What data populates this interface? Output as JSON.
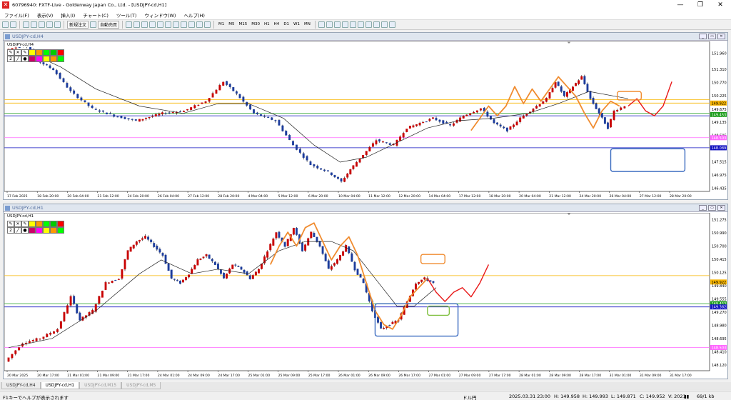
{
  "window": {
    "title": "60796940: FXTF-Live - Goldenway Japan Co., Ltd. - [USDJPY-cd,H1]",
    "minimize": "—",
    "restore": "❐",
    "close": "✕"
  },
  "menu": [
    "ファイル(F)",
    "表示(V)",
    "挿入(I)",
    "チャート(C)",
    "ツール(T)",
    "ウィンドウ(W)",
    "ヘルプ(H)"
  ],
  "toolbar": {
    "new_order": "新規注文",
    "auto_trade": "自動売買",
    "timeframes": [
      "M1",
      "M5",
      "M15",
      "M30",
      "H1",
      "H4",
      "D1",
      "W1",
      "MN"
    ]
  },
  "palette": {
    "num": "2",
    "colors": [
      "#ffff00",
      "#ff9900",
      "#00ff00",
      "#00cc00",
      "#ff0000",
      "#cc0066",
      "#ff00ff"
    ]
  },
  "icons": {
    "cross": "✕",
    "pen": "✎",
    "line": "╱",
    "dot": "●"
  },
  "charts": {
    "h4": {
      "window_title": "USDJPY-cd,H4",
      "symbol": "USDJPY-cd,H4",
      "price_labels": [
        "152.390",
        "151.960",
        "151.310",
        "150.770",
        "150.225",
        "149.675",
        "149.135",
        "148.595",
        "148.055",
        "147.515",
        "146.975",
        "146.435"
      ],
      "price_range": [
        146.3,
        152.45
      ],
      "tags": [
        {
          "text": "149.922",
          "price": 149.922,
          "bg": "#f7b500",
          "fg": "#000000"
        },
        {
          "text": "149.453",
          "price": 149.453,
          "bg": "#1a9c1a",
          "fg": "#ffffff"
        },
        {
          "text": "148.503",
          "price": 148.503,
          "bg": "#ff66ff",
          "fg": "#ffffff"
        },
        {
          "text": "148.089",
          "price": 148.089,
          "bg": "#1010c0",
          "fg": "#ffffff"
        }
      ],
      "hlines": [
        {
          "price": 150.06,
          "color": "#f7b500"
        },
        {
          "price": 149.922,
          "color": "#f7b500"
        },
        {
          "price": 149.5,
          "color": "#1a9c1a"
        },
        {
          "price": 149.4,
          "color": "#1010c0"
        },
        {
          "price": 148.503,
          "color": "#ff66ff"
        },
        {
          "price": 148.089,
          "color": "#1010c0"
        }
      ],
      "time_labels": [
        "17 Feb 2025",
        "18 Feb 20:00",
        "20 Feb 04:00",
        "21 Feb 12:00",
        "24 Feb 20:00",
        "26 Feb 04:00",
        "27 Feb 12:00",
        "28 Feb 20:00",
        "4 Mar 04:00",
        "5 Mar 12:00",
        "6 Mar 20:00",
        "10 Mar 04:00",
        "11 Mar 12:00",
        "12 Mar 20:00",
        "14 Mar 04:00",
        "17 Mar 12:00",
        "18 Mar 20:00",
        "20 Mar 04:00",
        "21 Mar 12:00",
        "24 Mar 20:00",
        "26 Mar 04:00",
        "27 Mar 12:00",
        "28 Mar 20:00"
      ],
      "path": [
        [
          0,
          152.1
        ],
        [
          10,
          152.3
        ],
        [
          16,
          151.6
        ],
        [
          22,
          151.3
        ],
        [
          30,
          150.4
        ],
        [
          40,
          149.7
        ],
        [
          50,
          149.4
        ],
        [
          60,
          149.2
        ],
        [
          72,
          149.5
        ],
        [
          82,
          149.6
        ],
        [
          92,
          150.0
        ],
        [
          100,
          150.8
        ],
        [
          106,
          150.3
        ],
        [
          114,
          149.5
        ],
        [
          124,
          149.2
        ],
        [
          132,
          148.2
        ],
        [
          140,
          147.4
        ],
        [
          148,
          147.1
        ],
        [
          154,
          146.7
        ],
        [
          158,
          147.2
        ],
        [
          164,
          147.8
        ],
        [
          170,
          148.4
        ],
        [
          178,
          148.2
        ],
        [
          184,
          148.9
        ],
        [
          190,
          149.1
        ],
        [
          196,
          149.3
        ],
        [
          204,
          149.0
        ],
        [
          210,
          149.4
        ],
        [
          218,
          149.7
        ],
        [
          224,
          149.1
        ],
        [
          230,
          148.8
        ],
        [
          236,
          149.3
        ],
        [
          242,
          149.7
        ],
        [
          248,
          150.1
        ],
        [
          252,
          150.8
        ],
        [
          256,
          150.2
        ],
        [
          260,
          150.6
        ],
        [
          264,
          151.0
        ],
        [
          268,
          150.1
        ],
        [
          272,
          149.5
        ],
        [
          276,
          148.9
        ],
        [
          279,
          149.6
        ],
        [
          284,
          149.8
        ]
      ],
      "ma_path": [
        [
          0,
          152.0
        ],
        [
          12,
          151.9
        ],
        [
          24,
          151.4
        ],
        [
          40,
          150.5
        ],
        [
          60,
          149.8
        ],
        [
          80,
          149.5
        ],
        [
          96,
          149.9
        ],
        [
          110,
          149.9
        ],
        [
          126,
          149.3
        ],
        [
          140,
          148.2
        ],
        [
          152,
          147.5
        ],
        [
          164,
          147.7
        ],
        [
          178,
          148.3
        ],
        [
          192,
          148.9
        ],
        [
          206,
          149.2
        ],
        [
          222,
          149.3
        ],
        [
          238,
          149.5
        ],
        [
          252,
          149.9
        ],
        [
          266,
          150.4
        ],
        [
          284,
          150.1
        ]
      ],
      "proj_path": [
        [
          284,
          149.8
        ],
        [
          288,
          150.1
        ],
        [
          292,
          149.6
        ],
        [
          296,
          149.4
        ],
        [
          300,
          149.8
        ],
        [
          304,
          150.8
        ]
      ],
      "swing_path": [
        [
          212,
          148.8
        ],
        [
          216,
          149.3
        ],
        [
          220,
          149.8
        ],
        [
          224,
          149.4
        ],
        [
          228,
          149.8
        ],
        [
          232,
          150.6
        ],
        [
          236,
          149.9
        ],
        [
          240,
          150.5
        ],
        [
          244,
          150.0
        ],
        [
          248,
          150.5
        ],
        [
          252,
          151.0
        ],
        [
          256,
          150.6
        ],
        [
          260,
          150.2
        ],
        [
          264,
          149.5
        ],
        [
          268,
          148.9
        ],
        [
          272,
          149.6
        ],
        [
          276,
          150.0
        ],
        [
          280,
          149.8
        ]
      ]
    },
    "h1": {
      "window_title": "USDJPY-cd,H1",
      "symbol": "USDJPY-cd,H1",
      "price_labels": [
        "151.275",
        "150.990",
        "150.700",
        "150.415",
        "150.125",
        "149.840",
        "149.555",
        "149.270",
        "148.980",
        "148.695",
        "148.410",
        "148.120"
      ],
      "price_range": [
        148.0,
        151.42
      ],
      "tags": [
        {
          "text": "149.922",
          "price": 149.922,
          "bg": "#f7b500",
          "fg": "#000000"
        },
        {
          "text": "149.453",
          "price": 149.453,
          "bg": "#1a9c1a",
          "fg": "#ffffff"
        },
        {
          "text": "149.382",
          "price": 149.382,
          "bg": "#1010c0",
          "fg": "#ffffff"
        },
        {
          "text": "148.503",
          "price": 148.503,
          "bg": "#ff66ff",
          "fg": "#ffffff"
        }
      ],
      "hlines": [
        {
          "price": 150.06,
          "color": "#f7b500"
        },
        {
          "price": 149.453,
          "color": "#1a9c1a"
        },
        {
          "price": 149.382,
          "color": "#1010c0"
        },
        {
          "price": 148.503,
          "color": "#ff66ff"
        }
      ],
      "time_labels": [
        "20 Mar 2025",
        "20 Mar 17:00",
        "21 Mar 01:00",
        "21 Mar 09:00",
        "21 Mar 17:00",
        "24 Mar 01:00",
        "24 Mar 09:00",
        "24 Mar 17:00",
        "25 Mar 01:00",
        "25 Mar 09:00",
        "25 Mar 17:00",
        "26 Mar 01:00",
        "26 Mar 09:00",
        "26 Mar 17:00",
        "27 Mar 01:00",
        "27 Mar 09:00",
        "27 Mar 17:00",
        "28 Mar 01:00",
        "28 Mar 09:00",
        "28 Mar 17:00",
        "31 Mar 01:00",
        "31 Mar 09:00",
        "31 Mar 17:00"
      ],
      "path": [
        [
          0,
          148.2
        ],
        [
          8,
          148.6
        ],
        [
          16,
          148.7
        ],
        [
          24,
          148.9
        ],
        [
          30,
          149.6
        ],
        [
          34,
          149.1
        ],
        [
          40,
          149.3
        ],
        [
          46,
          149.9
        ],
        [
          52,
          150.0
        ],
        [
          56,
          150.6
        ],
        [
          60,
          150.8
        ],
        [
          64,
          150.9
        ],
        [
          68,
          150.7
        ],
        [
          72,
          150.5
        ],
        [
          76,
          150.0
        ],
        [
          80,
          149.9
        ],
        [
          84,
          150.1
        ],
        [
          88,
          150.4
        ],
        [
          92,
          150.5
        ],
        [
          96,
          150.3
        ],
        [
          100,
          150.0
        ],
        [
          104,
          150.3
        ],
        [
          108,
          150.2
        ],
        [
          112,
          150.0
        ],
        [
          116,
          150.2
        ],
        [
          120,
          150.6
        ],
        [
          124,
          151.0
        ],
        [
          128,
          150.7
        ],
        [
          132,
          151.1
        ],
        [
          136,
          150.6
        ],
        [
          140,
          151.0
        ],
        [
          144,
          150.7
        ],
        [
          148,
          150.2
        ],
        [
          152,
          150.4
        ],
        [
          156,
          150.7
        ],
        [
          160,
          150.2
        ],
        [
          164,
          149.9
        ],
        [
          168,
          149.3
        ],
        [
          172,
          148.9
        ],
        [
          176,
          149.0
        ],
        [
          180,
          149.1
        ],
        [
          184,
          149.5
        ],
        [
          188,
          149.9
        ],
        [
          192,
          150.0
        ],
        [
          196,
          149.9
        ]
      ],
      "ma_path": [
        [
          0,
          148.5
        ],
        [
          20,
          148.7
        ],
        [
          40,
          149.3
        ],
        [
          60,
          150.1
        ],
        [
          70,
          150.4
        ],
        [
          84,
          150.1
        ],
        [
          96,
          150.2
        ],
        [
          110,
          150.1
        ],
        [
          124,
          150.6
        ],
        [
          136,
          150.8
        ],
        [
          148,
          150.8
        ],
        [
          158,
          150.6
        ],
        [
          168,
          150.0
        ],
        [
          178,
          149.4
        ],
        [
          186,
          149.4
        ],
        [
          196,
          149.8
        ]
      ],
      "proj_path": [
        [
          192,
          150.0
        ],
        [
          196,
          149.7
        ],
        [
          200,
          149.5
        ],
        [
          204,
          149.7
        ],
        [
          208,
          149.8
        ],
        [
          212,
          149.6
        ],
        [
          216,
          149.9
        ],
        [
          220,
          150.3
        ]
      ],
      "swing_path": [
        [
          120,
          150.3
        ],
        [
          124,
          150.7
        ],
        [
          128,
          151.0
        ],
        [
          132,
          150.7
        ],
        [
          136,
          151.1
        ],
        [
          140,
          151.2
        ],
        [
          144,
          150.8
        ],
        [
          148,
          150.4
        ],
        [
          152,
          150.7
        ],
        [
          156,
          150.9
        ],
        [
          160,
          150.5
        ],
        [
          164,
          149.9
        ],
        [
          168,
          149.3
        ],
        [
          172,
          149.0
        ],
        [
          176,
          148.9
        ],
        [
          180,
          149.2
        ],
        [
          184,
          149.6
        ],
        [
          188,
          149.8
        ],
        [
          192,
          150.0
        ]
      ]
    }
  },
  "tabs": [
    "USDJPY-cd,H4",
    "USDJPY-cd,H1",
    "USDJPY-cd,M15",
    "USDJPY-cd,M5"
  ],
  "status": {
    "hint": "F1キーでヘルプが表示されます",
    "profile": "ドル円",
    "time": "2025.03.31 23:00",
    "open": "H: 149.958",
    "high": "H: 149.993",
    "low": "L: 149.871",
    "close": "C: 149.952",
    "volume": "V: 2021",
    "traffic": "69/1 kb"
  }
}
